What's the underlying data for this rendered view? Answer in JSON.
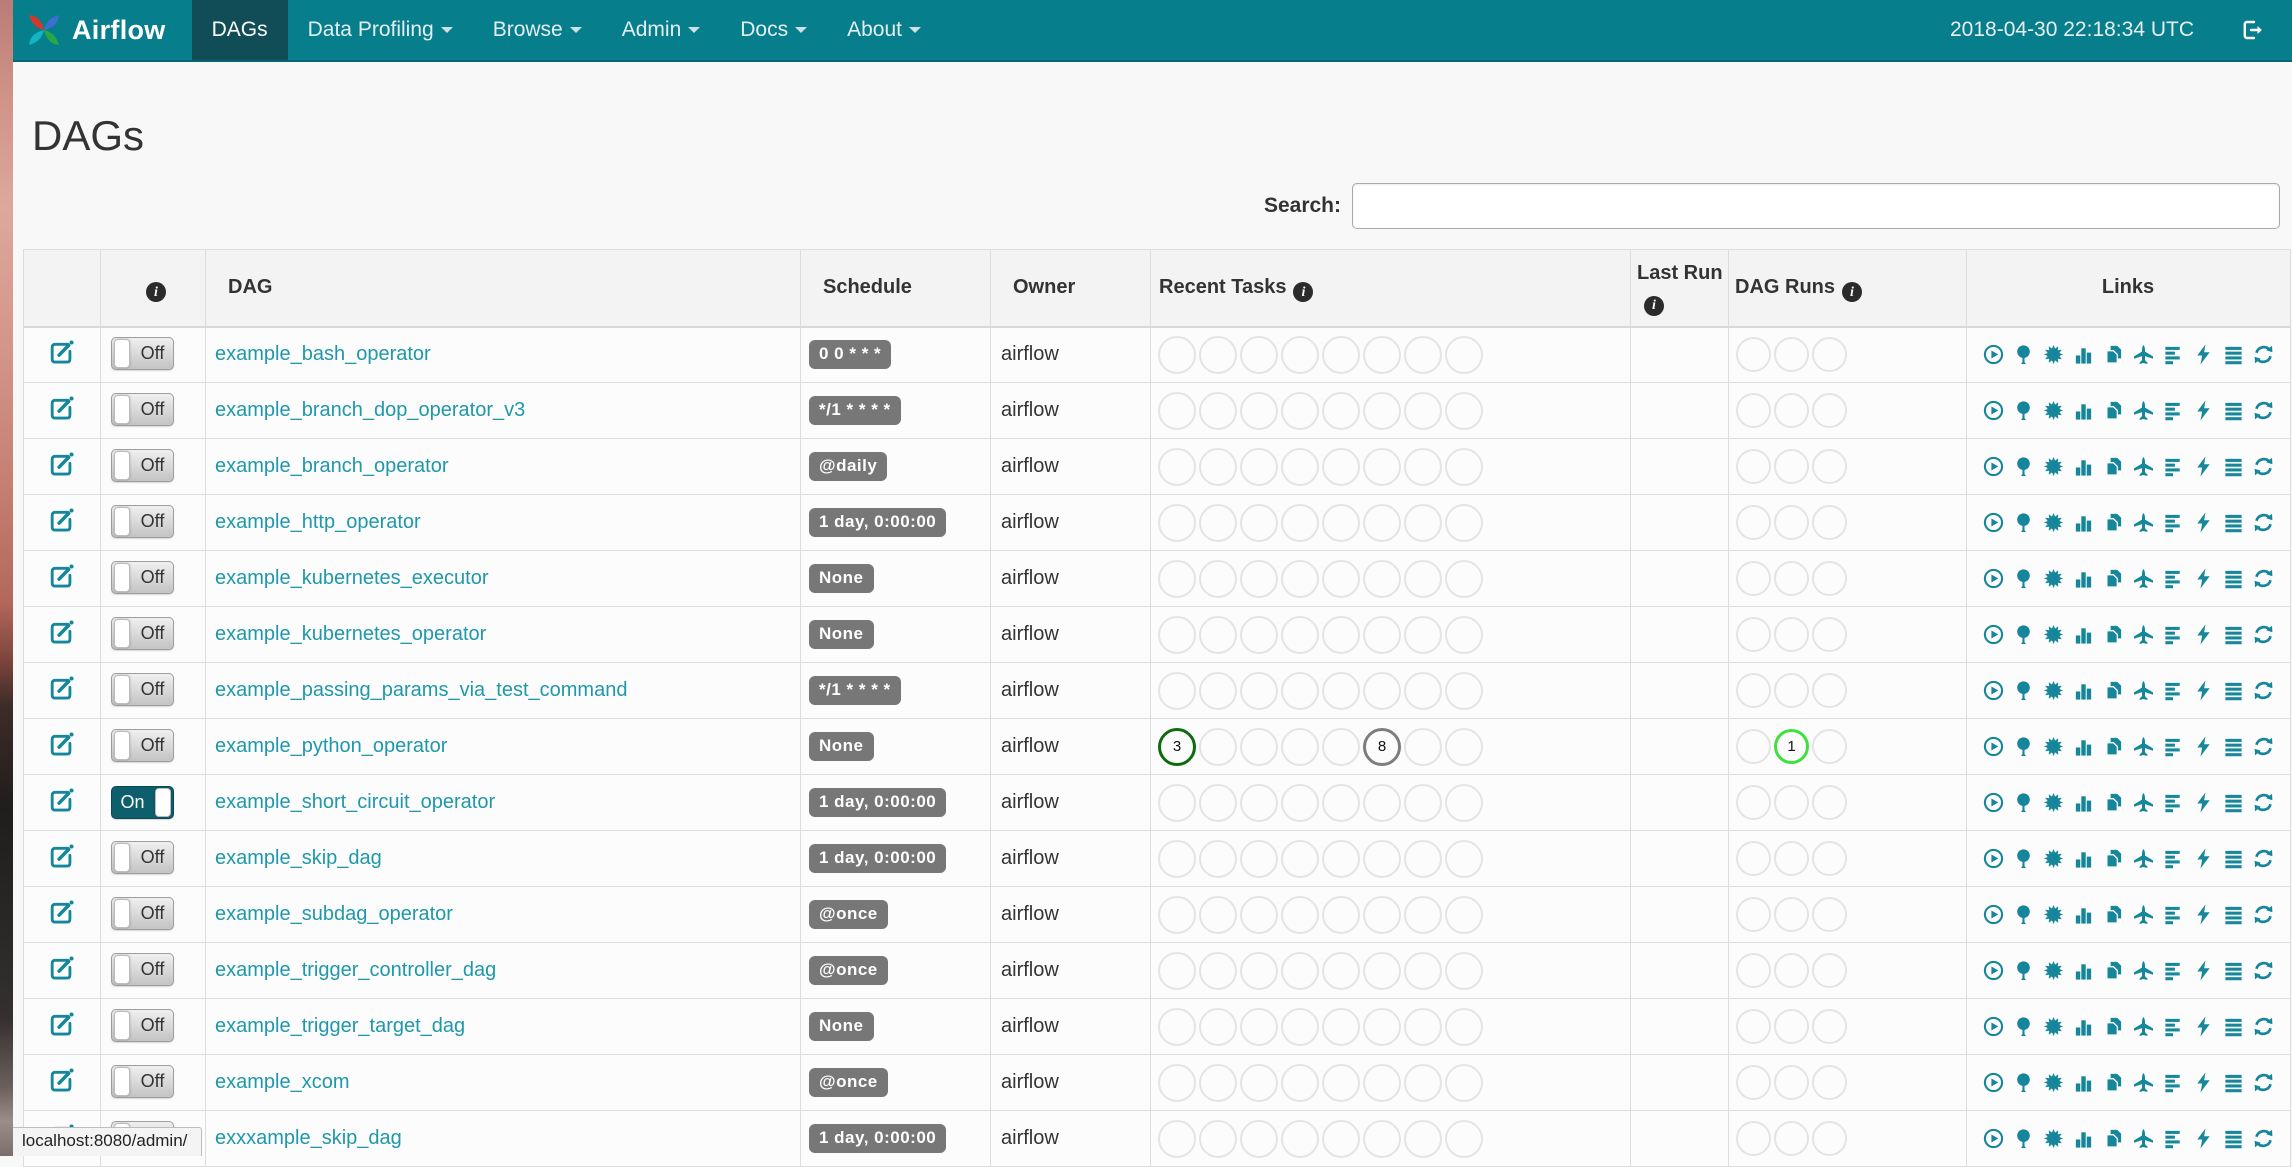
{
  "navbar": {
    "brand": "Airflow",
    "items": [
      {
        "label": "DAGs",
        "active": true,
        "dropdown": false
      },
      {
        "label": "Data Profiling",
        "active": false,
        "dropdown": true
      },
      {
        "label": "Browse",
        "active": false,
        "dropdown": true
      },
      {
        "label": "Admin",
        "active": false,
        "dropdown": true
      },
      {
        "label": "Docs",
        "active": false,
        "dropdown": true
      },
      {
        "label": "About",
        "active": false,
        "dropdown": true
      }
    ],
    "clock": "2018-04-30 22:18:34 UTC"
  },
  "page": {
    "title": "DAGs",
    "search_label": "Search:",
    "search_value": "",
    "status_bar": "localhost:8080/admin/"
  },
  "colors": {
    "brand-teal": "#077E8C",
    "active-tab": "#114D56",
    "link-teal": "#1F98AA",
    "icon-teal": "#16879B",
    "badge-bg": "#777777",
    "toggle-on": "#0E5F6D",
    "state-success": "#0E6B0E",
    "state-gray": "#7D7D7D",
    "state-running": "#3FE03F"
  },
  "table": {
    "headers": [
      {
        "label": "",
        "info": false,
        "align": "center"
      },
      {
        "label": "",
        "info": true,
        "align": "center"
      },
      {
        "label": "DAG",
        "info": false
      },
      {
        "label": "Schedule",
        "info": false
      },
      {
        "label": "Owner",
        "info": false
      },
      {
        "label": "Recent Tasks",
        "info": true,
        "pad": "sm"
      },
      {
        "label": "Last Run",
        "info": true,
        "pad": "xs"
      },
      {
        "label": "DAG Runs",
        "info": true,
        "pad": "xs"
      },
      {
        "label": "Links",
        "info": false,
        "align": "center"
      }
    ],
    "recent_tasks_slots": 8,
    "dag_runs_slots": 3,
    "rows": [
      {
        "dag": "example_bash_operator",
        "toggle": "Off",
        "schedule": "0 0 * * *",
        "owner": "airflow",
        "last_run": "",
        "recent_tasks": [],
        "dag_runs": []
      },
      {
        "dag": "example_branch_dop_operator_v3",
        "toggle": "Off",
        "schedule": "*/1 * * * *",
        "owner": "airflow",
        "last_run": "",
        "recent_tasks": [],
        "dag_runs": []
      },
      {
        "dag": "example_branch_operator",
        "toggle": "Off",
        "schedule": "@daily",
        "owner": "airflow",
        "last_run": "",
        "recent_tasks": [],
        "dag_runs": []
      },
      {
        "dag": "example_http_operator",
        "toggle": "Off",
        "schedule": "1 day, 0:00:00",
        "owner": "airflow",
        "last_run": "",
        "recent_tasks": [],
        "dag_runs": []
      },
      {
        "dag": "example_kubernetes_executor",
        "toggle": "Off",
        "schedule": "None",
        "owner": "airflow",
        "last_run": "",
        "recent_tasks": [],
        "dag_runs": []
      },
      {
        "dag": "example_kubernetes_operator",
        "toggle": "Off",
        "schedule": "None",
        "owner": "airflow",
        "last_run": "",
        "recent_tasks": [],
        "dag_runs": []
      },
      {
        "dag": "example_passing_params_via_test_command",
        "toggle": "Off",
        "schedule": "*/1 * * * *",
        "owner": "airflow",
        "last_run": "",
        "recent_tasks": [],
        "dag_runs": []
      },
      {
        "dag": "example_python_operator",
        "toggle": "Off",
        "schedule": "None",
        "owner": "airflow",
        "last_run": "",
        "recent_tasks": [
          {
            "slot": 0,
            "value": "3",
            "color_key": "state-success"
          },
          {
            "slot": 5,
            "value": "8",
            "color_key": "state-gray"
          }
        ],
        "dag_runs": [
          {
            "slot": 1,
            "value": "1",
            "color_key": "state-running"
          }
        ]
      },
      {
        "dag": "example_short_circuit_operator",
        "toggle": "On",
        "schedule": "1 day, 0:00:00",
        "owner": "airflow",
        "last_run": "",
        "recent_tasks": [],
        "dag_runs": []
      },
      {
        "dag": "example_skip_dag",
        "toggle": "Off",
        "schedule": "1 day, 0:00:00",
        "owner": "airflow",
        "last_run": "",
        "recent_tasks": [],
        "dag_runs": []
      },
      {
        "dag": "example_subdag_operator",
        "toggle": "Off",
        "schedule": "@once",
        "owner": "airflow",
        "last_run": "",
        "recent_tasks": [],
        "dag_runs": []
      },
      {
        "dag": "example_trigger_controller_dag",
        "toggle": "Off",
        "schedule": "@once",
        "owner": "airflow",
        "last_run": "",
        "recent_tasks": [],
        "dag_runs": []
      },
      {
        "dag": "example_trigger_target_dag",
        "toggle": "Off",
        "schedule": "None",
        "owner": "airflow",
        "last_run": "",
        "recent_tasks": [],
        "dag_runs": []
      },
      {
        "dag": "example_xcom",
        "toggle": "Off",
        "schedule": "@once",
        "owner": "airflow",
        "last_run": "",
        "recent_tasks": [],
        "dag_runs": []
      },
      {
        "dag": "exxxample_skip_dag",
        "toggle": "Off",
        "schedule": "1 day, 0:00:00",
        "owner": "airflow",
        "last_run": "",
        "recent_tasks": [],
        "dag_runs": []
      }
    ]
  },
  "links_icons": [
    "trigger-dag-icon",
    "tree-view-icon",
    "graph-view-icon",
    "task-duration-icon",
    "task-tries-icon",
    "landing-times-icon",
    "gantt-view-icon",
    "code-view-icon",
    "logs-icon",
    "refresh-icon"
  ]
}
